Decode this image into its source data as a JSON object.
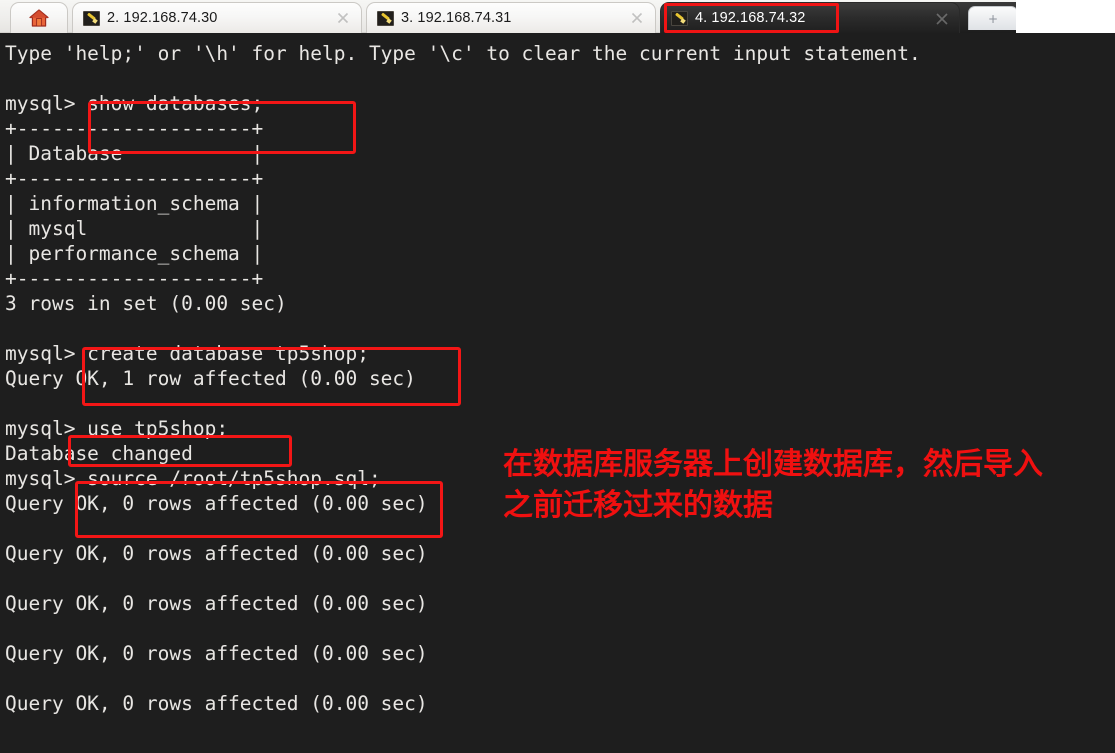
{
  "window": {
    "kind": "ssh-terminal-client",
    "background_color": "#1e1e1e",
    "accent_color": "#f31616"
  },
  "tabbar": {
    "home_tab": {
      "name": "home-tab",
      "icon": "home-icon",
      "label": ""
    },
    "tabs": [
      {
        "label": "2. 192.168.74.30",
        "icon": "terminal-session-icon",
        "active": false,
        "close_icon": "close-icon"
      },
      {
        "label": "3. 192.168.74.31",
        "icon": "terminal-session-icon",
        "active": false,
        "close_icon": "close-icon"
      },
      {
        "label": "4. 192.168.74.32",
        "icon": "terminal-session-icon",
        "active": true,
        "close_icon": "close-icon"
      }
    ],
    "new_tab": {
      "label": "+",
      "icon": "plus-icon"
    }
  },
  "terminal": {
    "lines": [
      "Type 'help;' or '\\h' for help. Type '\\c' to clear the current input statement.",
      "",
      "mysql> show databases;",
      "+--------------------+",
      "| Database           |",
      "+--------------------+",
      "| information_schema |",
      "| mysql              |",
      "| performance_schema |",
      "+--------------------+",
      "3 rows in set (0.00 sec)",
      "",
      "mysql> create database tp5shop;",
      "Query OK, 1 row affected (0.00 sec)",
      "",
      "mysql> use tp5shop;",
      "Database changed",
      "mysql> source /root/tp5shop.sql;",
      "Query OK, 0 rows affected (0.00 sec)",
      "",
      "Query OK, 0 rows affected (0.00 sec)",
      "",
      "Query OK, 0 rows affected (0.00 sec)",
      "",
      "Query OK, 0 rows affected (0.00 sec)",
      "",
      "Query OK, 0 rows affected (0.00 sec)"
    ]
  },
  "annotations": {
    "highlight_boxes": [
      {
        "name": "highlight-show-databases",
        "target": "show databases;"
      },
      {
        "name": "highlight-create-database",
        "target": "create database tp5shop;"
      },
      {
        "name": "highlight-use-database",
        "target": "use tp5shop;"
      },
      {
        "name": "highlight-source-sql",
        "target": "source /root/tp5shop.sql;"
      },
      {
        "name": "highlight-active-tab",
        "target": "4. 192.168.74.32"
      }
    ],
    "note_text": "在数据库服务器上创建数据库，然后导入\n之前迁移过来的数据",
    "note_color": "#f01010"
  }
}
